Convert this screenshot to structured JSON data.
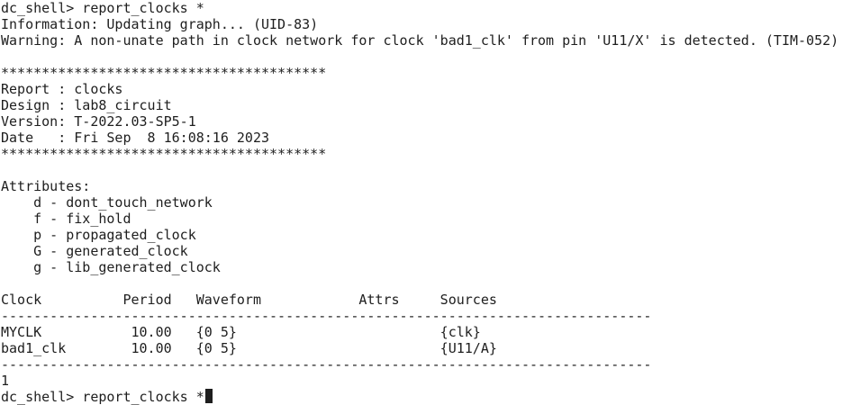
{
  "terminal": {
    "lines": [
      "dc_shell> report_clocks *",
      "Information: Updating graph... (UID-83)",
      "Warning: A non-unate path in clock network for clock 'bad1_clk' from pin 'U11/X' is detected. (TIM-052)",
      "",
      "****************************************",
      "Report : clocks",
      "Design : lab8_circuit",
      "Version: T-2022.03-SP5-1",
      "Date   : Fri Sep  8 16:08:16 2023",
      "****************************************",
      "",
      "Attributes:",
      "    d - dont_touch_network",
      "    f - fix_hold",
      "    p - propagated_clock",
      "    G - generated_clock",
      "    g - lib_generated_clock",
      "",
      "Clock          Period   Waveform            Attrs     Sources",
      "--------------------------------------------------------------------------------",
      "MYCLK           10.00   {0 5}                         {clk}",
      "bad1_clk        10.00   {0 5}                         {U11/A}",
      "--------------------------------------------------------------------------------",
      "1"
    ],
    "prompt": "dc_shell> ",
    "input": "report_clocks *"
  }
}
